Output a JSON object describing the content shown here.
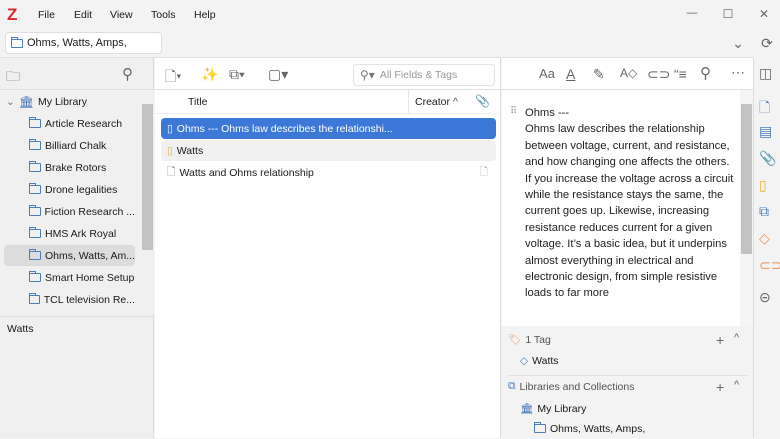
{
  "app": {
    "logo": "Z",
    "menu": [
      "File",
      "Edit",
      "View",
      "Tools",
      "Help"
    ]
  },
  "window_controls": {
    "minimize": "—",
    "maximize": "☐",
    "close": "✕"
  },
  "tab": {
    "label": "Ohms, Watts, Amps,"
  },
  "collections": {
    "library": "My Library",
    "items": [
      "Article Research",
      "Billiard Chalk",
      "Brake Rotors",
      "Drone legalities",
      "Fiction Research ...",
      "HMS Ark Royal",
      "Ohms, Watts, Am...",
      "Smart Home Setup",
      "TCL television Re..."
    ],
    "selected_index": 6
  },
  "tag_selector": {
    "tags": [
      "Watts"
    ]
  },
  "search": {
    "placeholder": "All Fields & Tags"
  },
  "items_table": {
    "columns": {
      "title": "Title",
      "creator": "Creator"
    },
    "rows": [
      {
        "title": "Ohms --- Ohms law describes the relationshi...",
        "type": "note",
        "selected": true
      },
      {
        "title": "Watts",
        "type": "note-yellow"
      },
      {
        "title": "Watts and Ohms relationship",
        "type": "web-link",
        "attachment": true
      }
    ]
  },
  "note": {
    "heading": "Ohms ---",
    "body": "Ohms law describes the relationship between voltage, current, and resistance, and how changing one affects the others. If you increase the voltage across a circuit while the resistance stays the same, the current goes up. Likewise, increasing resistance reduces current for a given voltage. It’s a basic idea, but it underpins almost everything in electrical and electronic design, from simple resistive loads to far more"
  },
  "tags_section": {
    "title": "1 Tag",
    "tags": [
      "Watts"
    ]
  },
  "libraries_section": {
    "title": "Libraries and Collections",
    "library": "My Library",
    "collection": "Ohms, Watts, Amps,"
  },
  "colors": {
    "accent": "#3b78d8",
    "logo": "#d9272e",
    "tag": "#e8955a"
  }
}
